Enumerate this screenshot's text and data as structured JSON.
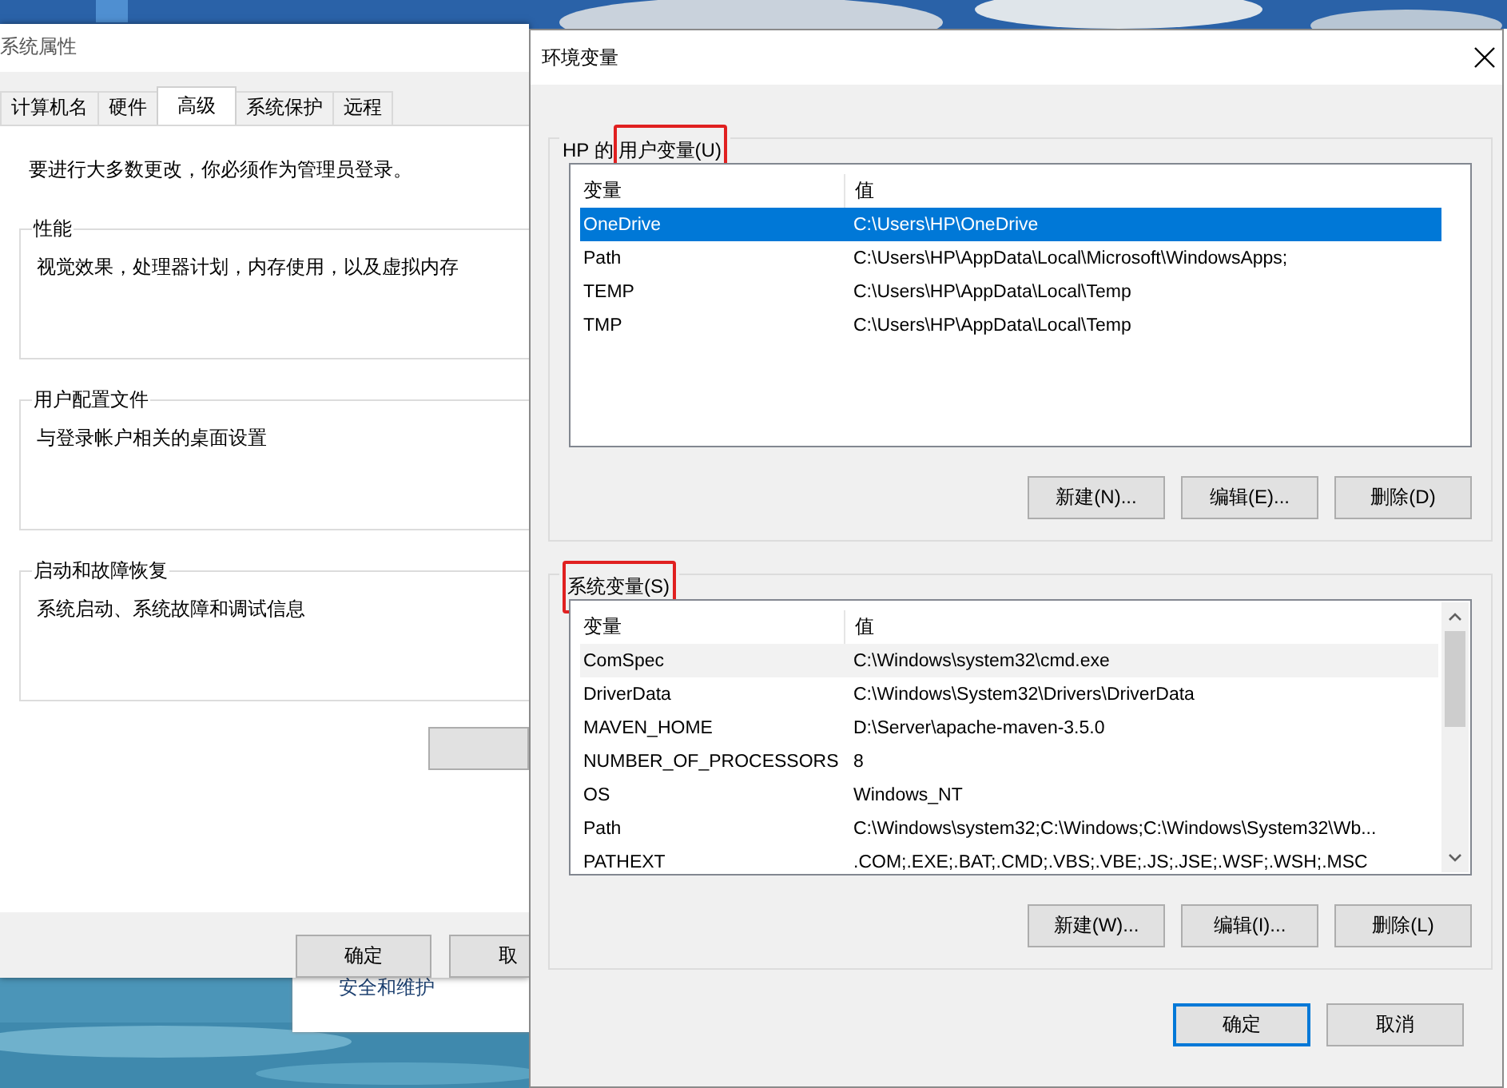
{
  "system_properties": {
    "title": "系统属性",
    "tabs": [
      {
        "label": "计算机名",
        "selected": false
      },
      {
        "label": "硬件",
        "selected": false
      },
      {
        "label": "高级",
        "selected": true
      },
      {
        "label": "系统保护",
        "selected": false
      },
      {
        "label": "远程",
        "selected": false
      }
    ],
    "notice": "要进行大多数更改，你必须作为管理员登录。",
    "groups": [
      {
        "title": "性能",
        "description": "视觉效果，处理器计划，内存使用，以及虚拟内存"
      },
      {
        "title": "用户配置文件",
        "description": "与登录帐户相关的桌面设置"
      },
      {
        "title": "启动和故障恢复",
        "description": "系统启动、系统故障和调试信息"
      }
    ],
    "buttons": [
      {
        "label": "确定"
      },
      {
        "label": "取"
      }
    ]
  },
  "background_window": {
    "item": "安全和维护"
  },
  "environment_variables": {
    "title": "环境变量",
    "user_variables": {
      "owner": "HP 的",
      "label": "用户变量(U)",
      "highlighted": true,
      "columns": [
        "变量",
        "值"
      ],
      "rows": [
        {
          "name": "OneDrive",
          "value": "C:\\Users\\HP\\OneDrive",
          "selected": true,
          "hovered": false
        },
        {
          "name": "Path",
          "value": "C:\\Users\\HP\\AppData\\Local\\Microsoft\\WindowsApps;",
          "selected": false,
          "hovered": false
        },
        {
          "name": "TEMP",
          "value": "C:\\Users\\HP\\AppData\\Local\\Temp",
          "selected": false,
          "hovered": false
        },
        {
          "name": "TMP",
          "value": "C:\\Users\\HP\\AppData\\Local\\Temp",
          "selected": false,
          "hovered": false
        }
      ],
      "buttons": [
        "新建(N)...",
        "编辑(E)...",
        "删除(D)"
      ]
    },
    "system_variables": {
      "label": "系统变量(S)",
      "highlighted": true,
      "columns": [
        "变量",
        "值"
      ],
      "rows": [
        {
          "name": "ComSpec",
          "value": "C:\\Windows\\system32\\cmd.exe",
          "selected": false,
          "hovered": true
        },
        {
          "name": "DriverData",
          "value": "C:\\Windows\\System32\\Drivers\\DriverData",
          "selected": false,
          "hovered": false
        },
        {
          "name": "MAVEN_HOME",
          "value": "D:\\Server\\apache-maven-3.5.0",
          "selected": false,
          "hovered": false
        },
        {
          "name": "NUMBER_OF_PROCESSORS",
          "value": "8",
          "selected": false,
          "hovered": false
        },
        {
          "name": "OS",
          "value": "Windows_NT",
          "selected": false,
          "hovered": false
        },
        {
          "name": "Path",
          "value": "C:\\Windows\\system32;C:\\Windows;C:\\Windows\\System32\\Wb...",
          "selected": false,
          "hovered": false
        },
        {
          "name": "PATHEXT",
          "value": ".COM;.EXE;.BAT;.CMD;.VBS;.VBE;.JS;.JSE;.WSF;.WSH;.MSC",
          "selected": false,
          "hovered": false
        }
      ],
      "buttons": [
        "新建(W)...",
        "编辑(I)...",
        "删除(L)"
      ]
    },
    "buttons": [
      {
        "label": "确定",
        "default": true
      },
      {
        "label": "取消",
        "default": false
      }
    ]
  }
}
